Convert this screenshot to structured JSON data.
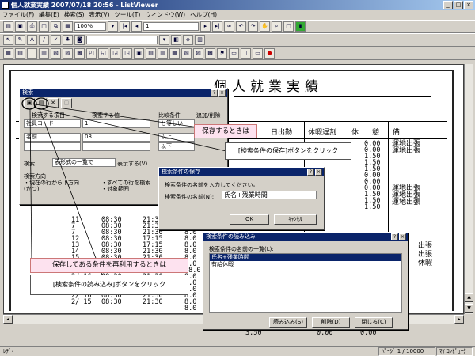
{
  "window": {
    "title": "個人就業実績 2007/07/18 20:56 - ListViewer",
    "min": "_",
    "max": "□",
    "close": "×"
  },
  "menu": [
    "ファイル(F)",
    "編集(E)",
    "検索(S)",
    "表示(V)",
    "ツール(T)",
    "ウィンドウ(W)",
    "ヘルプ(H)"
  ],
  "toolbar1": {
    "zoom": "100%",
    "page": "1"
  },
  "report": {
    "title": "個人就業実績",
    "headers": [
      "日出勤",
      "休暇遅刻",
      "休",
      "憩",
      "備"
    ],
    "days": [
      "11",
      "7",
      "7",
      "12",
      "13",
      "14",
      "15",
      "16",
      "2/ 15",
      "2/ 16",
      "2/ 23",
      "2/ 20",
      "2/ 10",
      "2/ 15"
    ],
    "starts": [
      "08:30",
      "08:30",
      "08:30",
      "08:30",
      "08:30",
      "08:30",
      "08:30",
      "08:30",
      "08:30",
      "08:30",
      "08:30",
      "08:30",
      "08:30",
      "08:30"
    ],
    "ends": [
      "21:30",
      "21:30",
      "21:30",
      "17:15",
      "17:15",
      "21:30",
      "21:30",
      "21:30",
      "21:30",
      "21:30",
      "21:30",
      "21:30",
      "21:30",
      "21:30"
    ],
    "hours": [
      "3.0",
      "8.0",
      "8.0",
      "8.0",
      "8.0",
      "8.0",
      "8.0",
      "8.0",
      "28.0",
      "8.0",
      "8.0",
      "8.0",
      "8.0",
      "8.0",
      "8.0"
    ],
    "rest1": [
      "0.00",
      "0.00",
      "1.50",
      "1.50",
      "1.50",
      "0.00",
      "0.00",
      "0.00",
      "1.50",
      "1.50",
      "1.50"
    ],
    "notes1": [
      "運地出張",
      "運地出張"
    ],
    "notes2": [
      "運地出張",
      "運地出張",
      "運地出張"
    ],
    "notes3": [
      "出張",
      "出張",
      "休暇"
    ],
    "last_row": {
      "hours": "3.50",
      "a": "0.00",
      "b": "0.00"
    }
  },
  "search_dialog": {
    "title": "検索",
    "col1": "検索する項目",
    "col2": "検索する値",
    "col3": "比較条件",
    "col4": "追加/削除",
    "row1": {
      "field": "社員コード",
      "value": "1",
      "cond": "と等しい"
    },
    "row2": {
      "field": "名前",
      "value": "08",
      "cond": "以上"
    },
    "row3": {
      "field": "",
      "value": "",
      "cond": "以下"
    },
    "target_label": "検索",
    "display_label": "表示形式",
    "display_value": "表形式の一覧で",
    "display_suffix": "表示する(V)",
    "dir_label": "検索方向",
    "dir1": "・現在の行から下方向",
    "dir2": "・すべての行を検索",
    "dir3": "・対象範囲",
    "cond_op": "(かつ)"
  },
  "save_dialog": {
    "title": "検索条件の保存",
    "prompt": "検索条件の名前を入力してください。",
    "label": "検索条件の名前(N):",
    "value": "氏名+残業時間",
    "ok": "OK",
    "cancel": "ｷｬﾝｾﾙ"
  },
  "load_dialog": {
    "title": "検索条件の読み込み",
    "label": "検索条件の名前の一覧(L):",
    "items": [
      "氏名+残業時間",
      "有給休暇"
    ],
    "load": "読み込み(S)",
    "delete": "削除(D)",
    "close": "閉じる(C)"
  },
  "callouts": {
    "save_when": "保存するときは",
    "save_click": "[検索条件の保存]ボタンをクリック",
    "reuse_when": "保存してある条件を再利用するときは",
    "load_click": "[検索条件の読み込み]ボタンをクリック"
  },
  "status": {
    "left": "ﾚﾃﾞｨ",
    "page": "ﾍﾟｰｼﾞ 1 / 10000",
    "computer": "ﾏｲ ｺﾝﾋﾟｭｰﾀ"
  }
}
